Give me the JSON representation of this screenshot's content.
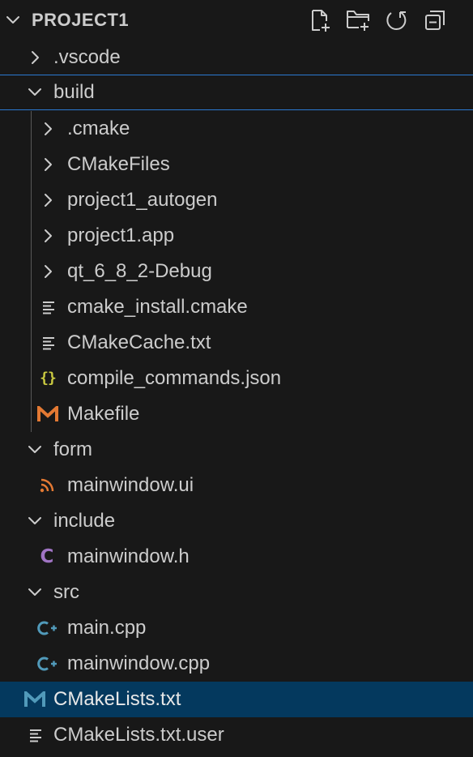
{
  "explorer": {
    "title": "PROJECT1"
  },
  "colors": {
    "background": "#181818",
    "text": "#cccccc",
    "focus_border": "#2b79d1",
    "selected_row": "#04395e",
    "makefile_icon": "#e37933",
    "cmakelists_icon": "#519aba",
    "ui_icon": "#e37933",
    "header_c_icon": "#a074c4",
    "cpp_icon": "#519aba",
    "json_icon": "#cbcb41"
  },
  "tree": [
    {
      "label": ".vscode",
      "type": "folder",
      "expanded": false,
      "icon": "chevron-right-icon"
    },
    {
      "label": "build",
      "type": "folder",
      "expanded": true,
      "icon": "chevron-down-icon",
      "focused": true
    },
    {
      "label": ".cmake",
      "type": "folder",
      "expanded": false,
      "icon": "chevron-right-icon"
    },
    {
      "label": "CMakeFiles",
      "type": "folder",
      "expanded": false,
      "icon": "chevron-right-icon"
    },
    {
      "label": "project1_autogen",
      "type": "folder",
      "expanded": false,
      "icon": "chevron-right-icon"
    },
    {
      "label": "project1.app",
      "type": "folder",
      "expanded": false,
      "icon": "chevron-right-icon"
    },
    {
      "label": "qt_6_8_2-Debug",
      "type": "folder",
      "expanded": false,
      "icon": "chevron-right-icon"
    },
    {
      "label": "cmake_install.cmake",
      "type": "file",
      "icon": "text-lines-icon"
    },
    {
      "label": "CMakeCache.txt",
      "type": "file",
      "icon": "text-lines-icon"
    },
    {
      "label": "compile_commands.json",
      "type": "file",
      "icon": "json-braces-icon"
    },
    {
      "label": "Makefile",
      "type": "file",
      "icon": "makefile-m-icon"
    },
    {
      "label": "form",
      "type": "folder",
      "expanded": true,
      "icon": "chevron-down-icon"
    },
    {
      "label": "mainwindow.ui",
      "type": "file",
      "icon": "rss-feed-icon"
    },
    {
      "label": "include",
      "type": "folder",
      "expanded": true,
      "icon": "chevron-down-icon"
    },
    {
      "label": "mainwindow.h",
      "type": "file",
      "icon": "c-header-icon"
    },
    {
      "label": "src",
      "type": "folder",
      "expanded": true,
      "icon": "chevron-down-icon"
    },
    {
      "label": "main.cpp",
      "type": "file",
      "icon": "cpp-icon"
    },
    {
      "label": "mainwindow.cpp",
      "type": "file",
      "icon": "cpp-icon"
    },
    {
      "label": "CMakeLists.txt",
      "type": "file",
      "icon": "cmake-m-icon",
      "selected": true
    },
    {
      "label": "CMakeLists.txt.user",
      "type": "file",
      "icon": "text-lines-icon"
    }
  ],
  "actions": [
    {
      "name": "new-file",
      "icon": "new-file-icon"
    },
    {
      "name": "new-folder",
      "icon": "new-folder-icon"
    },
    {
      "name": "refresh",
      "icon": "refresh-icon"
    },
    {
      "name": "collapse-all",
      "icon": "collapse-all-icon"
    }
  ]
}
